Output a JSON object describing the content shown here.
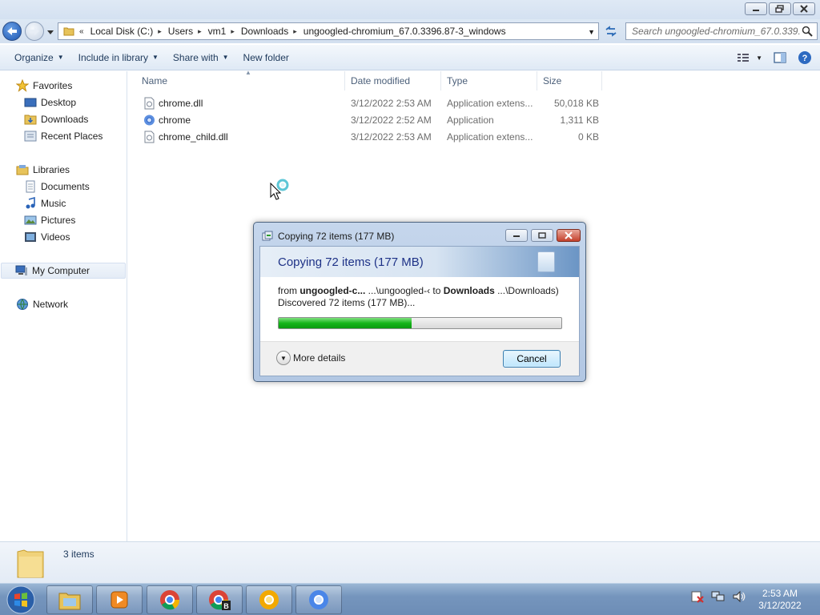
{
  "window": {
    "caption_buttons": [
      "minimize",
      "restore",
      "close"
    ]
  },
  "address": {
    "overflow": "«",
    "crumbs": [
      "Local Disk (C:)",
      "Users",
      "vm1",
      "Downloads",
      "ungoogled-chromium_67.0.3396.87-3_windows"
    ],
    "separator": "▸",
    "search_placeholder": "Search ungoogled-chromium_67.0.339..."
  },
  "toolbar": {
    "organize": "Organize",
    "include_in_library": "Include in library",
    "share_with": "Share with",
    "new_folder": "New folder"
  },
  "nav": {
    "favorites": "Favorites",
    "desktop": "Desktop",
    "downloads": "Downloads",
    "recent_places": "Recent Places",
    "libraries": "Libraries",
    "documents": "Documents",
    "music": "Music",
    "pictures": "Pictures",
    "videos": "Videos",
    "my_computer": "My Computer",
    "network": "Network"
  },
  "columns": {
    "name": "Name",
    "date_modified": "Date modified",
    "type": "Type",
    "size": "Size"
  },
  "files": [
    {
      "name": "chrome.dll",
      "date": "3/12/2022 2:53 AM",
      "type": "Application extens...",
      "size": "50,018 KB",
      "icon": "dll-icon"
    },
    {
      "name": "chrome",
      "date": "3/12/2022 2:52 AM",
      "type": "Application",
      "size": "1,311 KB",
      "icon": "chromium-app-icon"
    },
    {
      "name": "chrome_child.dll",
      "date": "3/12/2022 2:53 AM",
      "type": "Application extens...",
      "size": "0 KB",
      "icon": "dll-icon"
    }
  ],
  "dialog": {
    "title": "Copying 72 items (177 MB)",
    "heading": "Copying 72 items (177 MB)",
    "from_prefix": "from ",
    "from_name": "ungoogled-c...",
    "from_path": " ...\\ungoogled-‹ to ",
    "to_name": "Downloads",
    "to_path": " ...\\Downloads)",
    "discovered": "Discovered 72 items (177 MB)...",
    "progress_fraction": 0.47,
    "more_details": "More details",
    "cancel": "Cancel"
  },
  "details": {
    "item_count": "3 items"
  },
  "taskbar": {
    "apps": [
      "explorer",
      "media-player",
      "chromium",
      "chromium-b",
      "chrome-canary",
      "chromium-blue"
    ],
    "time": "2:53 AM",
    "date": "3/12/2022"
  },
  "colors": {
    "progress_green": "#16b51a",
    "dialog_heading": "#1e3287",
    "taskbar": "#7595bd"
  }
}
